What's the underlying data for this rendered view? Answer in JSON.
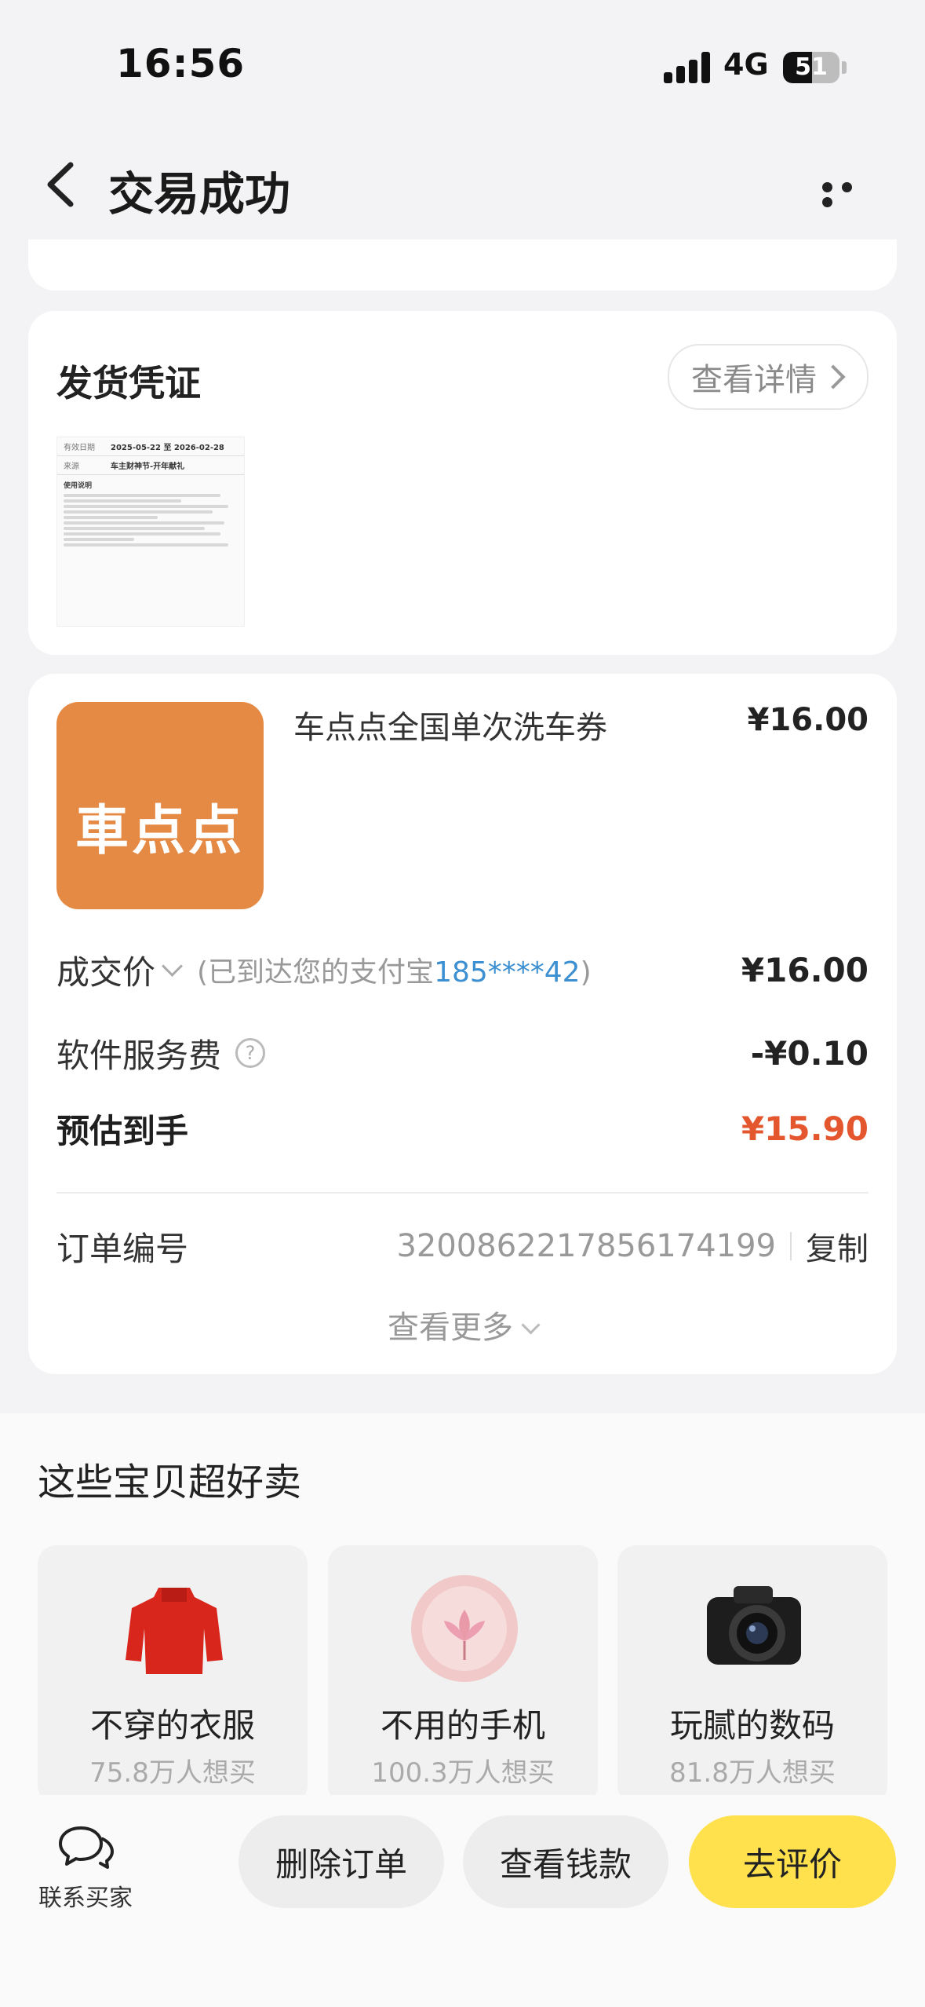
{
  "status_bar": {
    "time": "16:56",
    "network": "4G",
    "battery": "51",
    "battery_level": 0.51
  },
  "nav": {
    "title": "交易成功"
  },
  "proof": {
    "title": "发货凭证",
    "detail_button": "查看详情",
    "doc": {
      "valid_label": "有效日期",
      "valid_value": "2025-05-22 至 2026-02-28",
      "source_label": "来源",
      "source_value": "车主财神节-开年献礼",
      "usage_title": "使用说明"
    }
  },
  "order": {
    "product_name": "车点点全国单次洗车券",
    "product_price": "¥16.00",
    "thumb_logo": "車点点",
    "deal_label": "成交价",
    "deal_note_prefix": "(已到达您的支付宝",
    "deal_note_account": "185****42",
    "deal_note_suffix": ")",
    "deal_amount": "¥16.00",
    "fee_label": "软件服务费",
    "fee_amount": "-¥0.10",
    "receive_label": "预估到手",
    "receive_amount": "¥15.90",
    "order_no_label": "订单编号",
    "order_no": "3200862217856174199",
    "copy_label": "复制",
    "see_more": "查看更多"
  },
  "recommend": {
    "title": "这些宝贝超好卖",
    "items": [
      {
        "name": "不穿的衣服",
        "sub": "75.8万人想买",
        "icon": "sweater-icon"
      },
      {
        "name": "不用的手机",
        "sub": "100.3万人想买",
        "icon": "phone-icon"
      },
      {
        "name": "玩腻的数码",
        "sub": "81.8万人想买",
        "icon": "camera-icon"
      }
    ]
  },
  "bottom_bar": {
    "contact_label": "联系买家",
    "delete_order": "删除订单",
    "view_payment": "查看钱款",
    "review": "去评价"
  },
  "colors": {
    "accent": "#ffe14d",
    "orange": "#e4572e",
    "blue": "#3c8fd0"
  }
}
